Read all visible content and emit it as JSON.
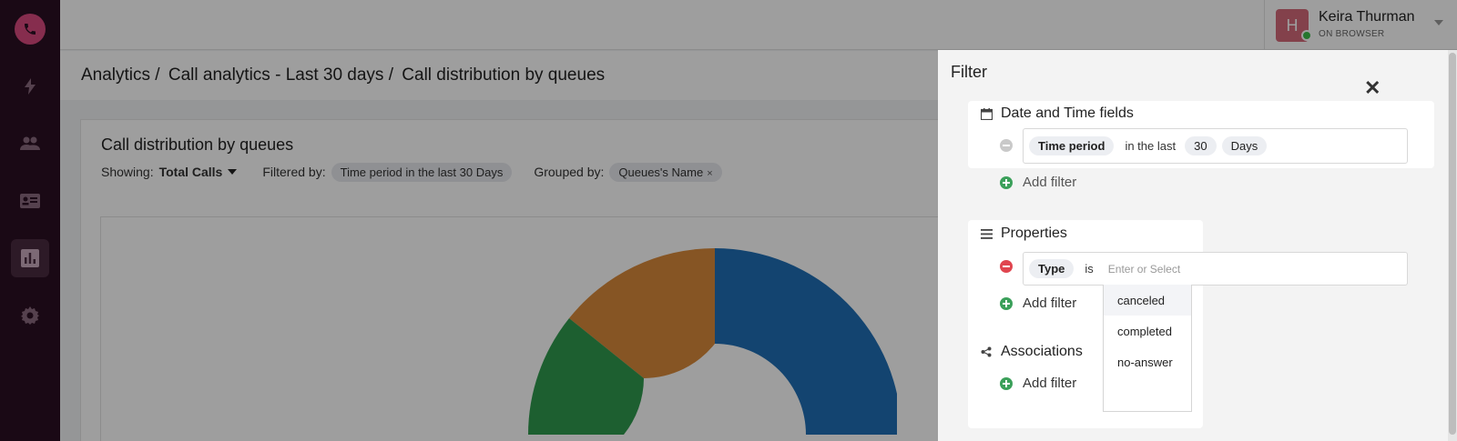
{
  "user": {
    "initial": "H",
    "name": "Keira Thurman",
    "status": "ON BROWSER"
  },
  "breadcrumb": {
    "part1": "Analytics /",
    "part2": "Call analytics - Last 30 days /",
    "part3": "Call distribution by queues"
  },
  "report": {
    "title": "Call distribution by queues",
    "showing_label": "Showing:",
    "showing_value": "Total Calls",
    "filtered_label": "Filtered by:",
    "filtered_chip": "Time period in the last 30 Days",
    "grouped_label": "Grouped by:",
    "grouped_chip": "Queues's Name",
    "grouped_chip_remove": "×"
  },
  "colors": {
    "series_blue": "#1f6fb5",
    "series_orange": "#d98a3a",
    "series_green": "#2f9a4e",
    "accent": "#d8497f"
  },
  "filter": {
    "title": "Filter",
    "close": "✕",
    "date_section": {
      "title": "Date and Time fields",
      "condition": {
        "field": "Time period",
        "operator": "in the last",
        "value": "30",
        "unit": "Days"
      },
      "add_label": "Add filter"
    },
    "properties_section": {
      "title": "Properties",
      "condition": {
        "field": "Type",
        "operator": "is",
        "placeholder": "Enter or Select"
      },
      "add_label": "Add filter",
      "options": [
        "canceled",
        "completed",
        "no-answer"
      ]
    },
    "associations_section": {
      "title": "Associations",
      "add_label": "Add filter"
    }
  }
}
